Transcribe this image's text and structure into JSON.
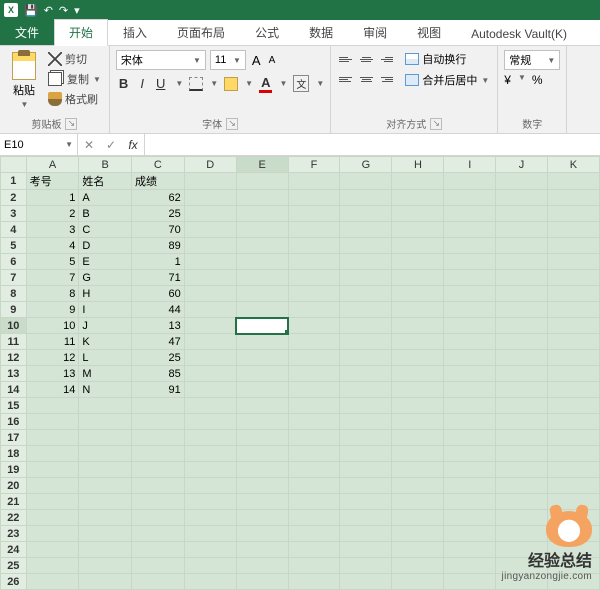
{
  "qat": {
    "save": "💾",
    "undo": "↶",
    "redo": "↷",
    "more": "▾"
  },
  "tabs": {
    "file": "文件",
    "items": [
      "开始",
      "插入",
      "页面布局",
      "公式",
      "数据",
      "审阅",
      "视图",
      "Autodesk Vault(K)"
    ],
    "active_index": 0
  },
  "ribbon": {
    "clipboard": {
      "label": "剪贴板",
      "paste": "粘贴",
      "cut": "剪切",
      "copy": "复制",
      "format_painter": "格式刷"
    },
    "font": {
      "label": "字体",
      "name": "宋体",
      "size": "11",
      "grow_a": "A",
      "shrink_a": "A",
      "bold": "B",
      "italic": "I",
      "underline": "U",
      "fontcolor_a": "A",
      "wen": "文"
    },
    "alignment": {
      "label": "对齐方式",
      "wrap": "自动换行",
      "merge": "合并后居中"
    },
    "number": {
      "label": "数字",
      "format": "常规",
      "percent": "%",
      "comma": ","
    }
  },
  "formula_bar": {
    "name_box": "E10",
    "value": ""
  },
  "columns": [
    "A",
    "B",
    "C",
    "D",
    "E",
    "F",
    "G",
    "H",
    "I",
    "J",
    "K"
  ],
  "selected_cell": {
    "row": 10,
    "col": "E"
  },
  "headers": {
    "A": "考号",
    "B": "姓名",
    "C": "成绩"
  },
  "rows": [
    {
      "r": 2,
      "A": "1",
      "B": "A",
      "C": "62"
    },
    {
      "r": 3,
      "A": "2",
      "B": "B",
      "C": "25"
    },
    {
      "r": 4,
      "A": "3",
      "B": "C",
      "C": "70"
    },
    {
      "r": 5,
      "A": "4",
      "B": "D",
      "C": "89"
    },
    {
      "r": 6,
      "A": "5",
      "B": "E",
      "C": "1"
    },
    {
      "r": 7,
      "A": "7",
      "B": "G",
      "C": "71"
    },
    {
      "r": 8,
      "A": "8",
      "B": "H",
      "C": "60"
    },
    {
      "r": 9,
      "A": "9",
      "B": "I",
      "C": "44"
    },
    {
      "r": 10,
      "A": "10",
      "B": "J",
      "C": "13"
    },
    {
      "r": 11,
      "A": "11",
      "B": "K",
      "C": "47"
    },
    {
      "r": 12,
      "A": "12",
      "B": "L",
      "C": "25"
    },
    {
      "r": 13,
      "A": "13",
      "B": "M",
      "C": "85"
    },
    {
      "r": 14,
      "A": "14",
      "B": "N",
      "C": "91"
    }
  ],
  "total_rows": 26,
  "watermark": {
    "line1": "经验总结",
    "line2": "jingyanzongjie.com"
  }
}
